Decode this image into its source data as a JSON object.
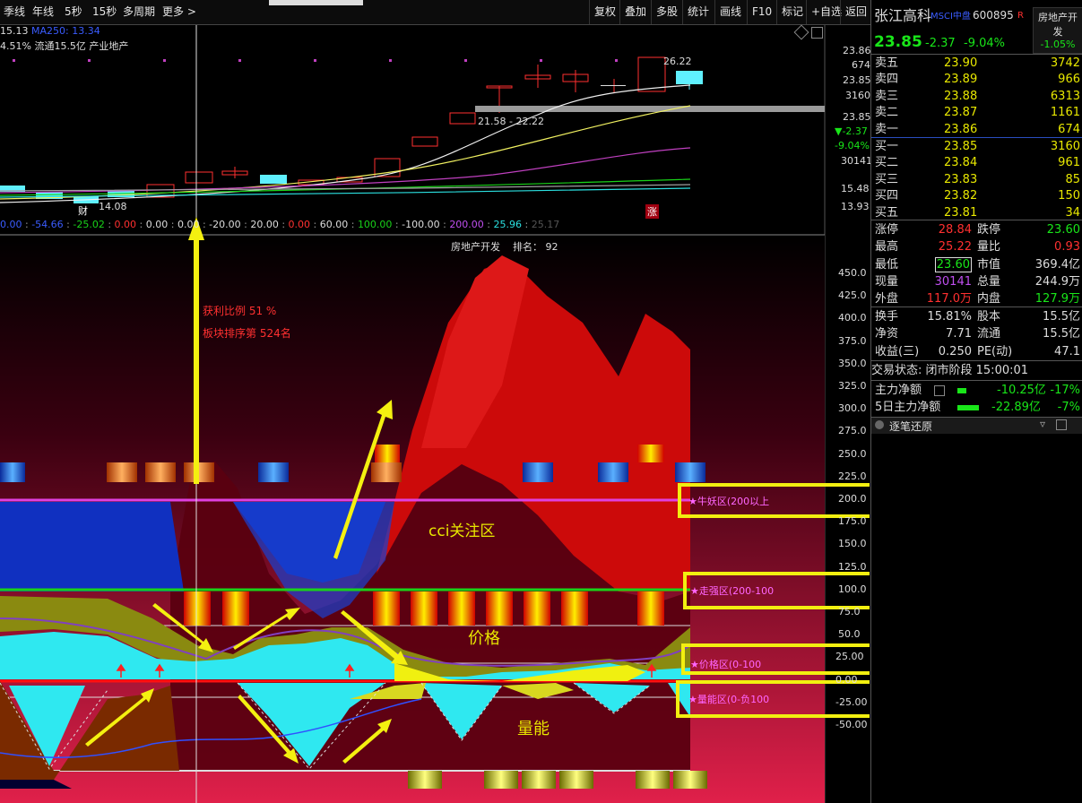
{
  "toolbar": {
    "left_items": [
      "季线",
      "年线",
      "5秒",
      "15秒",
      "多周期",
      "更多 >"
    ],
    "right_items": [
      "复权",
      "叠加",
      "多股",
      "统计",
      "画线",
      "F10",
      "标记",
      "+自选",
      "返回"
    ]
  },
  "chart_header": {
    "line1_value": "15.13",
    "line1_ma": "MA250: 13.34",
    "line2": "4.51% 流通15.5亿 产业地产"
  },
  "price_axis": [
    "23.86",
    "674",
    "23.85",
    "3160",
    "23.85",
    "▼-2.37",
    "-9.04%",
    "30141",
    "15.48",
    "13.93"
  ],
  "price_annotations": {
    "high": "26.22",
    "range": "21.58 - 22.22",
    "low": "14.08",
    "cai_badge": "财",
    "zhang_badge": "涨"
  },
  "indicator_values": [
    "0.00",
    "-54.66",
    "-25.02",
    "0.00",
    "0.00",
    "0.00",
    "-20.00",
    "20.00",
    "0.00",
    "60.00",
    "100.00",
    "-100.00",
    "200.00",
    "25.96",
    "25.17"
  ],
  "indicator_colors": [
    "#3a5cff",
    "#3a5cff",
    "#19d219",
    "#ff3030",
    "#dddddd",
    "#dddddd",
    "#dddddd",
    "#dddddd",
    "#ff3030",
    "#dddddd",
    "#19d219",
    "#dddddd",
    "#c04ff0",
    "#2be0e0",
    "#555555"
  ],
  "sector_header": {
    "sector": "房地产开发",
    "rank_label": "排名：",
    "rank_value": "92"
  },
  "sub_axis": [
    "450.0",
    "425.0",
    "400.0",
    "375.0",
    "350.0",
    "325.0",
    "300.0",
    "275.0",
    "250.0",
    "225.0",
    "200.0",
    "175.0",
    "150.0",
    "125.0",
    "100.0",
    "75.0",
    "50.0",
    "25.00",
    "0.00",
    "-25.00",
    "-50.00"
  ],
  "annotations": {
    "profit_ratio": "获利比例 51 %",
    "sector_rank": "板块排序第 524名",
    "cci_zone": "cci关注区",
    "price_label": "价格",
    "volume_label": "量能"
  },
  "zone_labels": {
    "bull": "★牛妖区(200以上",
    "strong": "★走强区(200-100",
    "price": "★价格区(0-100",
    "volume": "★量能区(0-负100"
  },
  "quote": {
    "name": "张江高科",
    "msci": "MSCI中盘",
    "code": "600895",
    "r_badge": "R",
    "sector": "房地产开发",
    "sector_change": "-1.05%",
    "price": "23.85",
    "change": "-2.37",
    "change_pct": "-9.04%",
    "asks": [
      {
        "label": "卖五",
        "price": "23.90",
        "vol": "3742"
      },
      {
        "label": "卖四",
        "price": "23.89",
        "vol": "966"
      },
      {
        "label": "卖三",
        "price": "23.88",
        "vol": "6313"
      },
      {
        "label": "卖二",
        "price": "23.87",
        "vol": "1161"
      },
      {
        "label": "卖一",
        "price": "23.86",
        "vol": "674"
      }
    ],
    "bids": [
      {
        "label": "买一",
        "price": "23.85",
        "vol": "3160"
      },
      {
        "label": "买二",
        "price": "23.84",
        "vol": "961"
      },
      {
        "label": "买三",
        "price": "23.83",
        "vol": "85"
      },
      {
        "label": "买四",
        "price": "23.82",
        "vol": "150"
      },
      {
        "label": "买五",
        "price": "23.81",
        "vol": "34"
      }
    ],
    "stats": [
      {
        "l1": "涨停",
        "v1": "28.84",
        "l2": "跌停",
        "v2": "23.60"
      },
      {
        "l1": "最高",
        "v1": "25.22",
        "l2": "量比",
        "v2": "0.93"
      },
      {
        "l1": "最低",
        "v1": "23.60",
        "l2": "市值",
        "v2": "369.4亿"
      },
      {
        "l1": "现量",
        "v1": "30141",
        "l2": "总量",
        "v2": "244.9万"
      },
      {
        "l1": "外盘",
        "v1": "117.0万",
        "l2": "内盘",
        "v2": "127.9万"
      }
    ],
    "stats2": [
      {
        "l1": "换手",
        "v1": "15.81%",
        "l2": "股本",
        "v2": "15.5亿"
      },
      {
        "l1": "净资",
        "v1": "7.71",
        "l2": "流通",
        "v2": "15.5亿"
      },
      {
        "l1": "收益(三)",
        "v1": "0.250",
        "l2": "PE(动)",
        "v2": "47.1"
      }
    ],
    "trade_status": "交易状态: 闭市阶段 15:00:01",
    "main_net": {
      "label": "主力净额",
      "value": "-10.25亿",
      "pct": "-17%"
    },
    "main_net5": {
      "label": "5日主力净额",
      "value": "-22.89亿",
      "pct": "-7%"
    },
    "tick_panel": "逐笔还原"
  }
}
